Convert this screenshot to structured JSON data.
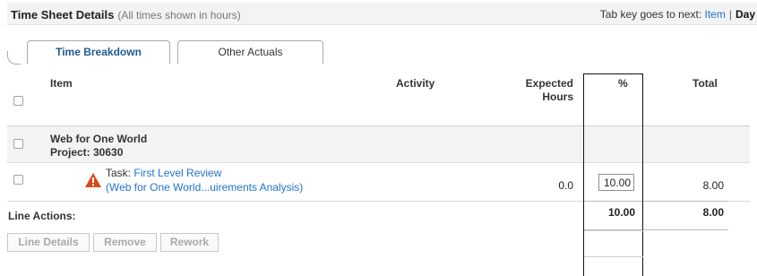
{
  "header": {
    "title": "Time Sheet Details",
    "subtitle": "(All times shown in hours)",
    "tab_key_text": "Tab key goes to next:",
    "item_link": "Item",
    "separator": "|",
    "day_label": "Day"
  },
  "tabs": [
    {
      "label": "Time Breakdown",
      "active": true
    },
    {
      "label": "Other Actuals",
      "active": false
    }
  ],
  "columns": {
    "item": "Item",
    "activity": "Activity",
    "expected_line1": "Expected",
    "expected_line2": "Hours",
    "percent": "%",
    "total": "Total"
  },
  "group": {
    "name": "Web for One World",
    "project": "Project: 30630"
  },
  "task": {
    "prefix": "Task:",
    "name": "First Level Review",
    "parent": "(Web for One World...uirements Analysis)",
    "expected_hours": "0.0",
    "percent": "10.00",
    "total": "8.00",
    "warning_icon": "warning-triangle-icon"
  },
  "totals": {
    "label": "Line Actions:",
    "percent": "10.00",
    "total": "8.00"
  },
  "buttons": {
    "line_details": "Line Details",
    "remove": "Remove",
    "rework": "Rework"
  },
  "colors": {
    "link": "#1f73c9",
    "active_tab": "#1d5c91",
    "warning": "#d9471c",
    "disabled_button_text": "#a9a9a9"
  }
}
